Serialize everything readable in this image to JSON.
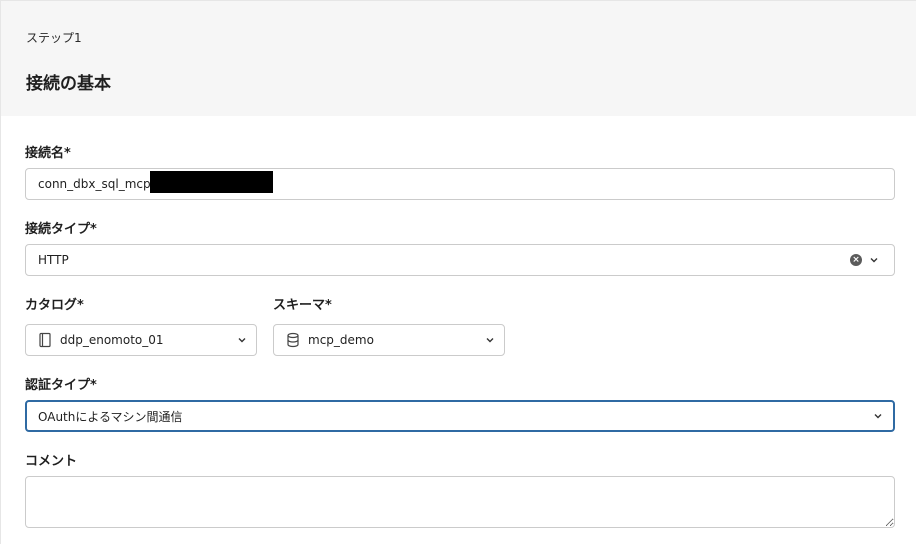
{
  "step": {
    "label": "ステップ1",
    "title": "接続の基本"
  },
  "fields": {
    "connection_name": {
      "label": "接続名*",
      "value": "conn_dbx_sql_mcp_"
    },
    "connection_type": {
      "label": "接続タイプ*",
      "value": "HTTP"
    },
    "catalog": {
      "label": "カタログ*",
      "value": "ddp_enomoto_01"
    },
    "schema": {
      "label": "スキーマ*",
      "value": "mcp_demo"
    },
    "auth_type": {
      "label": "認証タイプ*",
      "value": "OAuthによるマシン間通信"
    },
    "comment": {
      "label": "コメント",
      "value": ""
    }
  },
  "icons": {
    "clear": "clear-icon",
    "dropdown": "chevron-down-icon",
    "catalog": "catalog-book-icon",
    "schema": "database-icon"
  },
  "colors": {
    "header_bg": "#f6f6f6",
    "border": "#cbcbcb",
    "focus": "#2f6aa3"
  }
}
